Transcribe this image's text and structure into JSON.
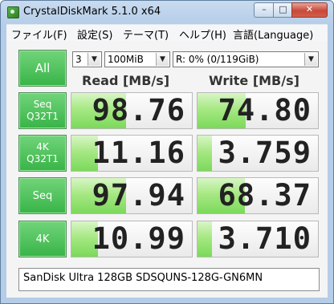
{
  "window": {
    "title": "CrystalDiskMark 5.1.0 x64",
    "controls": {
      "minimize": "–",
      "maximize": "□",
      "close": "✕"
    }
  },
  "menu": [
    "ファイル(F)",
    "設定(S)",
    "テーマ(T)",
    "ヘルプ(H)",
    "言語(Language)"
  ],
  "controls": {
    "all_label": "All",
    "count": "3",
    "size": "100MiB",
    "drive": "R: 0% (0/119GiB)"
  },
  "headers": {
    "read": "Read [MB/s]",
    "write": "Write [MB/s]"
  },
  "rows": [
    {
      "label_line1": "Seq",
      "label_line2": "Q32T1",
      "read": "98.76",
      "write": "74.80",
      "read_fill": 0.45,
      "write_fill": 0.4
    },
    {
      "label_line1": "4K",
      "label_line2": "Q32T1",
      "read": "11.16",
      "write": "3.759",
      "read_fill": 0.22,
      "write_fill": 0.12
    },
    {
      "label_line1": "Seq",
      "label_line2": "",
      "read": "97.94",
      "write": "68.37",
      "read_fill": 0.45,
      "write_fill": 0.39
    },
    {
      "label_line1": "4K",
      "label_line2": "",
      "read": "10.99",
      "write": "3.710",
      "read_fill": 0.22,
      "write_fill": 0.12
    }
  ],
  "status": "SanDisk Ultra 128GB SDSQUNS-128G-GN6MN",
  "colors": {
    "button_green": "#38b447",
    "bar_green": "#7bd95a",
    "title_bg": "#c9dbef",
    "close_red": "#c74a39"
  }
}
